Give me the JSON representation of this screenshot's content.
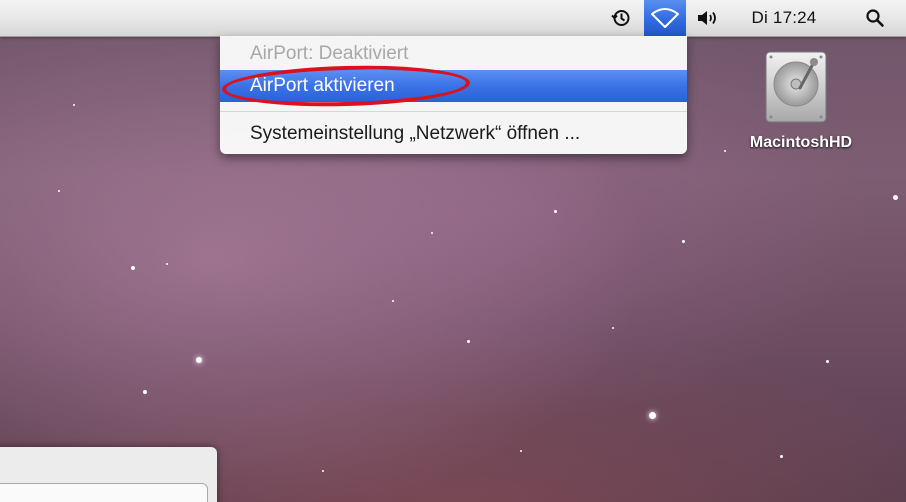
{
  "menubar": {
    "time_machine_icon": "time-machine-icon",
    "airport_icon": "airport-wifi-icon",
    "volume_icon": "volume-icon",
    "clock": "Di 17:24",
    "spotlight_icon": "spotlight-search-icon",
    "airport_active_color": "#3b73e6"
  },
  "airport_menu": {
    "status": "AirPort: Deaktiviert",
    "activate": "AirPort aktivieren",
    "network_prefs": "Systemeinstellung „Netzwerk“ öffnen ...",
    "highlight_color": "#d8131e"
  },
  "desktop": {
    "hd_label": "MacintoshHD",
    "hd_icon": "hard-drive-icon"
  }
}
